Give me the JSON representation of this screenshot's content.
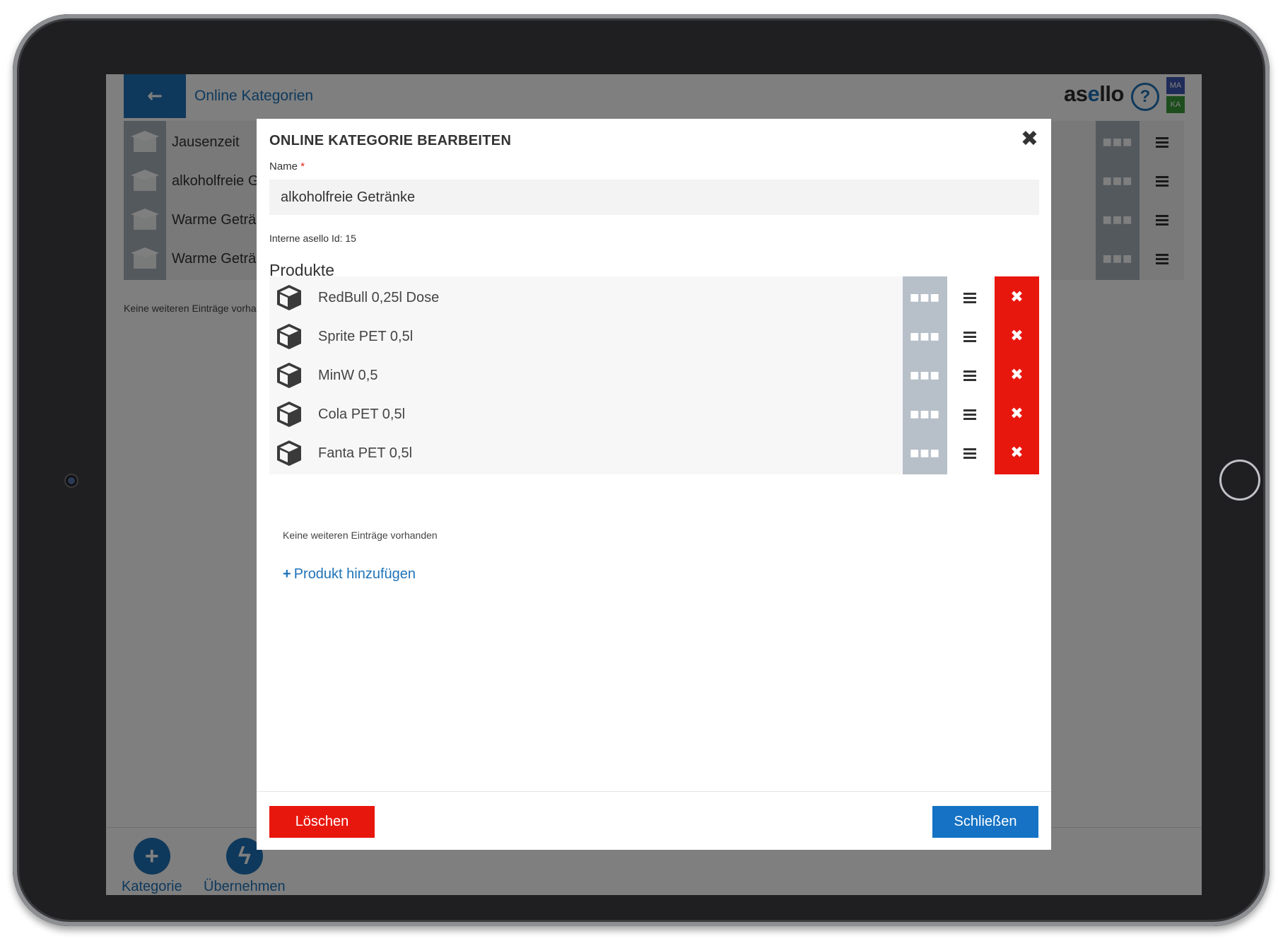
{
  "app": {
    "title": "Online Kategorien",
    "logo": "asello",
    "help": "?",
    "user_badges": [
      "MA",
      "KA"
    ]
  },
  "categories": [
    {
      "label": "Jausenzeit"
    },
    {
      "label": "alkoholfreie G"
    },
    {
      "label": "Warme Getränke"
    },
    {
      "label": "Warme Getränke"
    }
  ],
  "background_empty": "Keine weiteren Einträge vorhanden",
  "footer": {
    "add_category": "Kategorie",
    "apply": "Übernehmen"
  },
  "modal": {
    "title": "ONLINE KATEGORIE BEARBEITEN",
    "name_label": "Name",
    "required_mark": "*",
    "name_value": "alkoholfreie Getränke",
    "internal_id": "Interne asello Id: 15",
    "products_heading": "Produkte",
    "products": [
      {
        "label": "RedBull 0,25l Dose"
      },
      {
        "label": "Sprite PET 0,5l"
      },
      {
        "label": "MinW 0,5"
      },
      {
        "label": "Cola PET 0,5l"
      },
      {
        "label": "Fanta PET 0,5l"
      }
    ],
    "empty_text": "Keine weiteren Einträge vorhanden",
    "add_product": "Produkt hinzufügen",
    "delete_button": "Löschen",
    "close_button": "Schließen"
  },
  "colors": {
    "brand": "#1f73b8",
    "danger": "#e8170e",
    "primary": "#1572c4"
  },
  "icons": {
    "back": "arrow-left-icon",
    "close": "close-icon",
    "product": "box-icon",
    "more": "ellipsis-icon",
    "drag": "drag-handle-icon",
    "remove": "remove-icon",
    "add": "plus-icon",
    "bolt": "lightning-icon"
  }
}
